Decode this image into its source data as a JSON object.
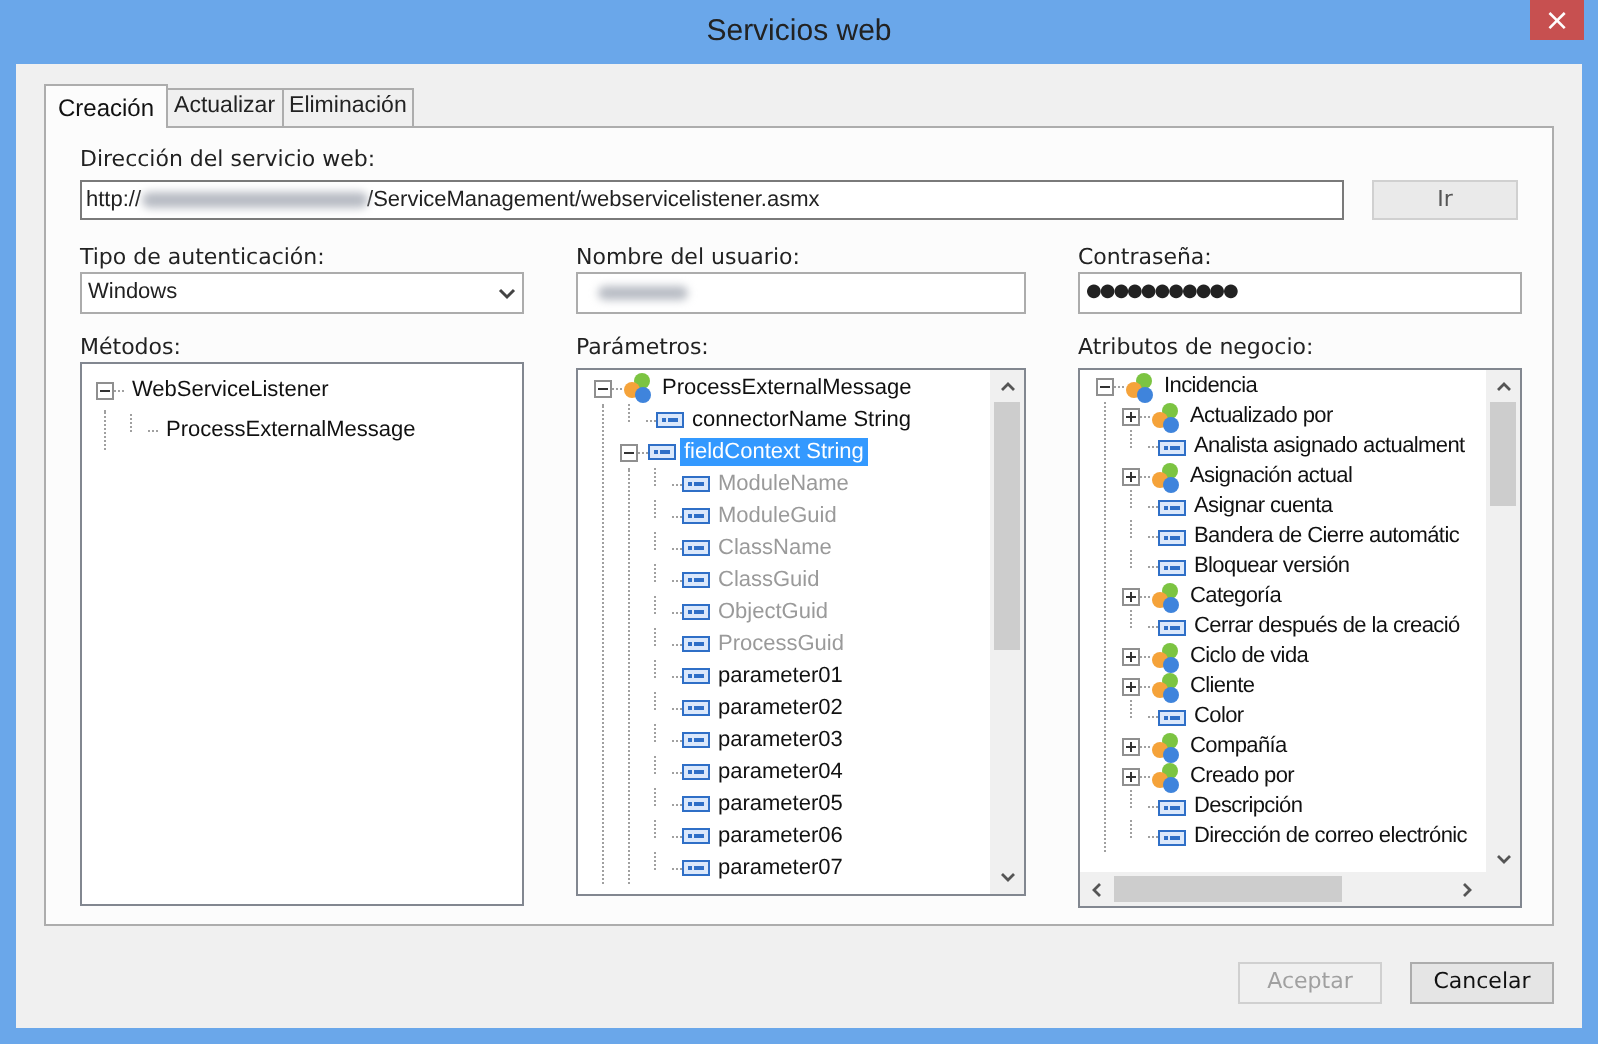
{
  "window": {
    "title": "Servicios web",
    "close": "×"
  },
  "tabs": [
    {
      "label": "Creación",
      "selected": true
    },
    {
      "label": "Actualizar",
      "selected": false
    },
    {
      "label": "Eliminación",
      "selected": false
    }
  ],
  "address": {
    "label": "Dirección del servicio web:",
    "value_start": "http://",
    "value_end": "/ServiceManagement/webservicelistener.asmx",
    "go_button": "Ir"
  },
  "auth": {
    "label": "Tipo de autenticación:",
    "value": "Windows"
  },
  "user": {
    "label": "Nombre del usuario:"
  },
  "password": {
    "label": "Contraseña:",
    "value": "●●●●●●●●●●●"
  },
  "methods": {
    "label": "Métodos:",
    "items": [
      {
        "label": "WebServiceListener",
        "expanded": true,
        "selected": false,
        "children": [
          {
            "label": "ProcessExternalMessage",
            "selected": false
          }
        ]
      }
    ]
  },
  "parameters": {
    "label": "Parámetros:",
    "items": [
      {
        "label": "ProcessExternalMessage",
        "kind": "class",
        "expanded": true,
        "selected": false,
        "children": [
          {
            "label": "connectorName String",
            "kind": "field",
            "selected": false
          },
          {
            "label": "fieldContext String",
            "kind": "field",
            "expanded": true,
            "selected": true,
            "children": [
              {
                "label": "ModuleName",
                "kind": "field",
                "disabled": true,
                "selected": false
              },
              {
                "label": "ModuleGuid",
                "kind": "field",
                "disabled": true,
                "selected": false
              },
              {
                "label": "ClassName",
                "kind": "field",
                "disabled": true,
                "selected": false
              },
              {
                "label": "ClassGuid",
                "kind": "field",
                "disabled": true,
                "selected": false
              },
              {
                "label": "ObjectGuid",
                "kind": "field",
                "disabled": true,
                "selected": false
              },
              {
                "label": "ProcessGuid",
                "kind": "field",
                "disabled": true,
                "selected": false
              },
              {
                "label": "parameter01",
                "kind": "field",
                "disabled": false,
                "selected": false
              },
              {
                "label": "parameter02",
                "kind": "field",
                "disabled": false,
                "selected": false
              },
              {
                "label": "parameter03",
                "kind": "field",
                "disabled": false,
                "selected": false
              },
              {
                "label": "parameter04",
                "kind": "field",
                "disabled": false,
                "selected": false
              },
              {
                "label": "parameter05",
                "kind": "field",
                "disabled": false,
                "selected": false
              },
              {
                "label": "parameter06",
                "kind": "field",
                "disabled": false,
                "selected": false
              },
              {
                "label": "parameter07",
                "kind": "field",
                "disabled": false,
                "selected": false
              }
            ]
          }
        ]
      }
    ]
  },
  "business_attributes": {
    "label": "Atributos de negocio:",
    "items": [
      {
        "label": "Incidencia",
        "kind": "class",
        "expanded": true,
        "selected": false,
        "children": [
          {
            "label": "Actualizado por",
            "kind": "class",
            "expanded": false,
            "selected": false
          },
          {
            "label": "Analista asignado actualment",
            "kind": "field",
            "selected": false
          },
          {
            "label": "Asignación actual",
            "kind": "class",
            "expanded": false,
            "selected": false
          },
          {
            "label": "Asignar cuenta",
            "kind": "field",
            "selected": false
          },
          {
            "label": "Bandera de Cierre automátic",
            "kind": "field",
            "selected": false
          },
          {
            "label": "Bloquear versión",
            "kind": "field",
            "selected": false
          },
          {
            "label": "Categoría",
            "kind": "class",
            "expanded": false,
            "selected": false
          },
          {
            "label": "Cerrar después de la creació",
            "kind": "field",
            "selected": false
          },
          {
            "label": "Ciclo de vida",
            "kind": "class",
            "expanded": false,
            "selected": false
          },
          {
            "label": "Cliente",
            "kind": "class",
            "expanded": false,
            "selected": false
          },
          {
            "label": "Color",
            "kind": "field",
            "selected": false
          },
          {
            "label": "Compañía",
            "kind": "class",
            "expanded": false,
            "selected": false
          },
          {
            "label": "Creado por",
            "kind": "class",
            "expanded": false,
            "selected": false
          },
          {
            "label": "Descripción",
            "kind": "field",
            "selected": false
          },
          {
            "label": "Dirección de correo electrónic",
            "kind": "field",
            "selected": false
          }
        ]
      }
    ]
  },
  "buttons": [
    {
      "label": "Aceptar",
      "disabled": true
    },
    {
      "label": "Cancelar",
      "disabled": false
    }
  ]
}
